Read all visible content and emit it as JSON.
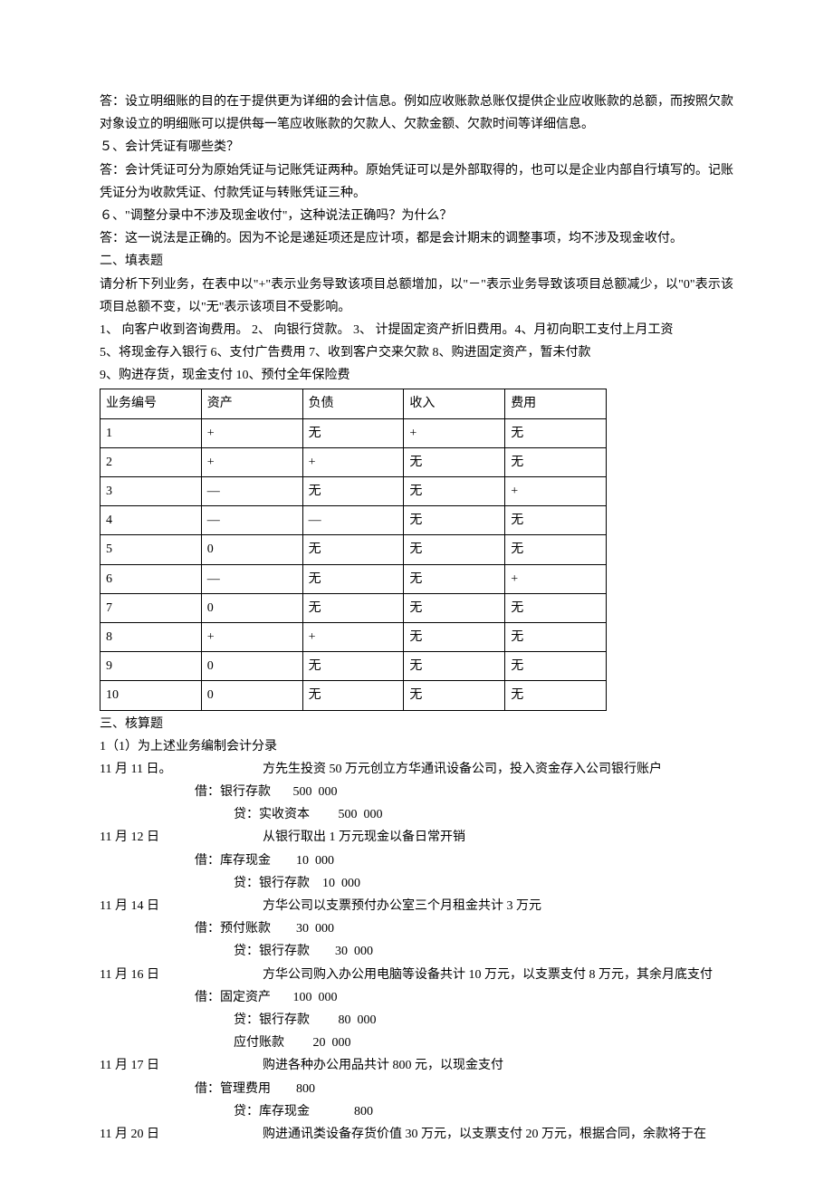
{
  "q_answers": {
    "a4_q": "答：设立明细账的目的在于提供更为详细的会计信息。例如应收账款总账仅提供企业应收账款的总额，而按照欠款对象设立的明细账可以提供每一笔应收账款的欠款人、欠款金额、欠款时间等详细信息。",
    "q5": "５、会计凭证有哪些类？",
    "a5": "答：会计凭证可分为原始凭证与记账凭证两种。原始凭证可以是外部取得的，也可以是企业内部自行填写的。记账凭证分为收款凭证、付款凭证与转账凭证三种。",
    "q6": "６、\"调整分录中不涉及现金收付\"，这种说法正确吗？为什么？",
    "a6": "答：这一说法是正确的。因为不论是递延项还是应计项，都是会计期末的调整事项，均不涉及现金收付。"
  },
  "section2": {
    "title": "二、填表题",
    "instruction": "请分析下列业务，在表中以\"+\"表示业务导致该项目总额增加，以\"－\"表示业务导致该项目总额减少，以\"0\"表示该项目总额不变，以\"无\"表示该项目不受影响。",
    "items_line1": "1、  向客户收到咨询费用。  2、  向银行贷款。  3、  计提固定资产折旧费用。4、月初向职工支付上月工资",
    "items_line2": "5、将现金存入银行              6、支付广告费用   7、收到客户交来欠款               8、购进固定资产，暂未付款",
    "items_line3": "9、购进存货，现金支付       10、预付全年保险费"
  },
  "table": {
    "headers": [
      "业务编号",
      "资产",
      "负债",
      "收入",
      "费用"
    ],
    "rows": [
      [
        "1",
        "+",
        "无",
        "+",
        "无"
      ],
      [
        "2",
        "+",
        "+",
        "无",
        "无"
      ],
      [
        "3",
        "—",
        "无",
        "无",
        "+"
      ],
      [
        "4",
        "—",
        "—",
        "无",
        "无"
      ],
      [
        "5",
        "0",
        "无",
        "无",
        "无"
      ],
      [
        "6",
        "—",
        "无",
        "无",
        "+"
      ],
      [
        "7",
        "0",
        "无",
        "无",
        "无"
      ],
      [
        "8",
        "+",
        "+",
        "无",
        "无"
      ],
      [
        "9",
        "0",
        "无",
        "无",
        "无"
      ],
      [
        "10",
        "0",
        "无",
        "无",
        "无"
      ]
    ]
  },
  "section3": {
    "title": "三、核算题",
    "subtitle": "1（1）为上述业务编制会计分录",
    "entries": [
      {
        "date": "11 月 11 日。",
        "desc": "方先生投资 50 万元创立方华通讯设备公司，投入资金存入公司银行账户",
        "lines": [
          {
            "type": "debit",
            "text": "借：银行存款       500  000"
          },
          {
            "type": "credit",
            "text": "贷：实收资本         500  000"
          }
        ]
      },
      {
        "date": "11 月 12 日",
        "desc": "从银行取出 1 万元现金以备日常开销",
        "lines": [
          {
            "type": "debit",
            "text": "借：库存现金        10  000"
          },
          {
            "type": "credit",
            "text": "贷：银行存款    10  000"
          }
        ]
      },
      {
        "date": "11 月 14 日",
        "desc": "方华公司以支票预付办公室三个月租金共计 3 万元",
        "lines": [
          {
            "type": "debit",
            "text": "借：预付账款        30  000"
          },
          {
            "type": "credit",
            "text": "贷：银行存款        30  000"
          }
        ]
      },
      {
        "date": "11 月 16 日",
        "desc": "方华公司购入办公用电脑等设备共计 10 万元，以支票支付 8 万元，其余月底支付",
        "lines": [
          {
            "type": "debit",
            "text": "借：固定资产       100  000"
          },
          {
            "type": "credit",
            "text": "贷：银行存款         80  000"
          },
          {
            "type": "credit",
            "text": "应付账款         20  000"
          }
        ]
      },
      {
        "date": "11 月 17 日",
        "desc": "购进各种办公用品共计 800 元，以现金支付",
        "lines": [
          {
            "type": "debit",
            "text": "借：管理费用        800"
          },
          {
            "type": "credit",
            "text": "贷：库存现金              800"
          }
        ]
      },
      {
        "date": "11 月 20 日",
        "desc": "购进通讯类设备存货价值 30 万元，以支票支付 20 万元，根据合同，余款将于在",
        "lines": []
      }
    ]
  }
}
